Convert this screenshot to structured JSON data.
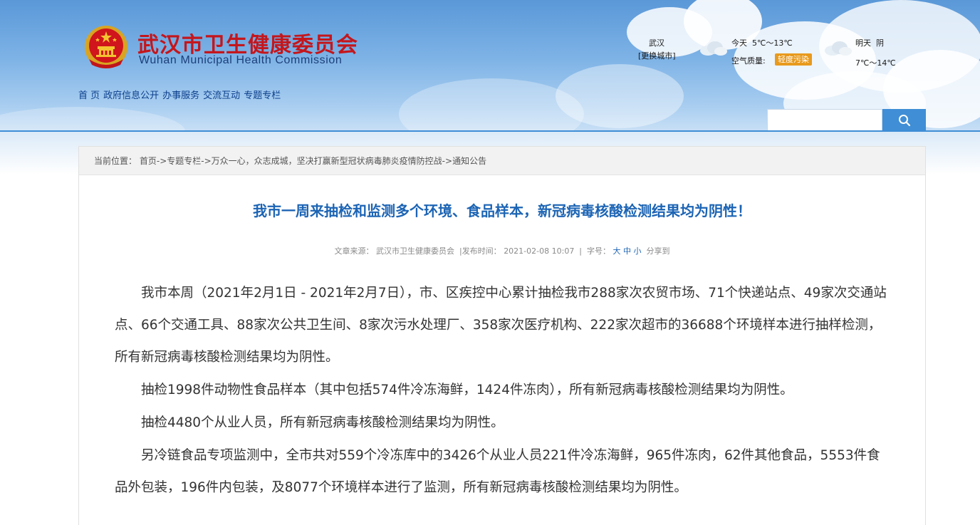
{
  "header": {
    "site_title_cn": "武汉市卫生健康委员会",
    "site_title_en": "Wuhan Municipal Health Commission",
    "nav": [
      "首 页",
      "政府信息公开",
      "办事服务",
      "交流互动",
      "专题专栏"
    ],
    "search": {
      "placeholder": ""
    }
  },
  "weather": {
    "city": "武汉",
    "change_city": "[更换城市]",
    "today_label": "今天",
    "today_temp": "5℃～13℃",
    "aqi_label": "空气质量:",
    "aqi_value": "轻度污染",
    "tomorrow_label": "明天",
    "tomorrow_condition": "阴",
    "tomorrow_temp": "7℃～14℃",
    "icon": "cloudy-icon"
  },
  "breadcrumb": {
    "label": "当前位置：",
    "items": [
      "首页",
      "专题专栏",
      "万众一心，众志成城，坚决打赢新型冠状病毒肺炎疫情防控战",
      "通知公告"
    ],
    "separator": "->"
  },
  "article": {
    "title": "我市一周来抽检和监测多个环境、食品样本，新冠病毒核酸检测结果均为阴性！",
    "meta": {
      "source_label": "文章来源：",
      "source": "武汉市卫生健康委员会",
      "date_label": "发布时间：",
      "date": "2021-02-08 10:07",
      "font_label": "字号：",
      "font_sizes": [
        "大",
        "中",
        "小"
      ],
      "share": "分享到"
    },
    "paragraphs": [
      "我市本周（2021年2月1日 - 2021年2月7日），市、区疾控中心累计抽检我市288家次农贸市场、71个快递站点、49家次交通站点、66个交通工具、88家次公共卫生间、8家次污水处理厂、358家次医疗机构、222家次超市的36688个环境样本进行抽样检测，所有新冠病毒核酸检测结果均为阴性。",
      "抽检1998件动物性食品样本（其中包括574件冷冻海鲜，1424件冻肉），所有新冠病毒核酸检测结果均为阴性。",
      "抽检4480个从业人员，所有新冠病毒核酸检测结果均为阴性。",
      "另冷链食品专项监测中，全市共对559个冷冻库中的3426个从业人员221件冷冻海鲜，965件冻肉，62件其他食品，5553件食品外包装，196件内包装，及8077个环境样本进行了监测，所有新冠病毒核酸检测结果均为阴性。"
    ]
  },
  "colors": {
    "header_blue": "#5a98d8",
    "title_red": "#c4161c",
    "link_blue": "#1c64b4",
    "aqi_orange": "#e89a1c"
  }
}
